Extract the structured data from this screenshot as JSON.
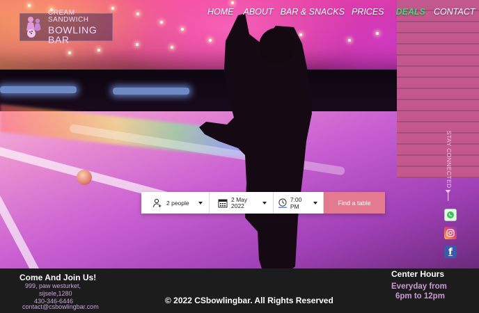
{
  "logo": {
    "line1": "CREAM SANDWICH",
    "line2": "BOWLING BAR"
  },
  "nav": {
    "items": [
      {
        "label": "HOME",
        "active": false
      },
      {
        "label": "ABOUT",
        "active": false
      },
      {
        "label": "BAR & SNACKS",
        "active": false
      },
      {
        "label": "PRICES",
        "active": false
      },
      {
        "label": "DEALS",
        "active": true
      },
      {
        "label": "CONTACT",
        "active": false
      }
    ]
  },
  "social": {
    "stay_connected": "STAY CONNECTED",
    "facebook_glyph": "f"
  },
  "booking": {
    "people": "2 people",
    "date_line1": "2 May",
    "date_line2": "2022",
    "time": "7:00 PM",
    "submit": "Find a table"
  },
  "footer": {
    "join_title": "Come And Join Us!",
    "address_line1": "999,  paw westurket,",
    "address_line2": "sijsele,1280",
    "phone": "430-346-6446",
    "email": "contact@csbowlingbar.com",
    "copyright": "© 2022 CSbowlingbar. All Rights Reserved",
    "hours_title": "Center Hours",
    "hours_line1": "Everyday from",
    "hours_line2": "6pm to 12pm"
  },
  "colors": {
    "nav_active": "#3fdc73",
    "booking_button": "#e47a8f",
    "footer_background": "#1c1c1c",
    "footer_accent_text": "#c89bd6"
  },
  "icons": {
    "logo": "bowling-pins-logo-icon",
    "people": "add-user-icon",
    "date": "calendar-icon",
    "time": "clock-icon",
    "dropdown": "chevron-down-icon",
    "stay_connected_arrow": "arrow-down-icon",
    "whatsapp": "whatsapp-icon",
    "instagram": "instagram-icon",
    "facebook": "facebook-icon"
  }
}
